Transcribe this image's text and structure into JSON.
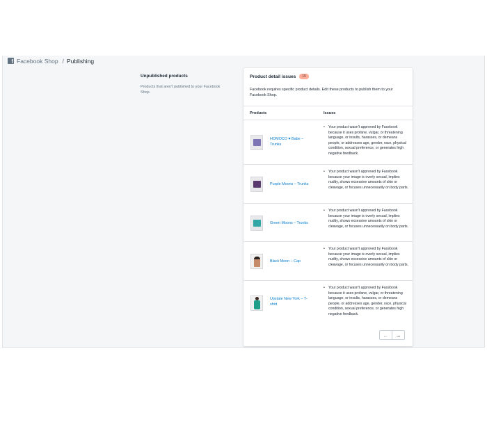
{
  "breadcrumb": {
    "app": "Facebook Shop",
    "current": "Publishing"
  },
  "section": {
    "title": "Unpublished products",
    "description": "Products that aren't published to your Facebook Shop."
  },
  "card": {
    "title": "Product detail issues",
    "badge": "15",
    "description": "Facebook requires specific product details. Edit these products to publish them to your Facebook Shop.",
    "col_products": "Products",
    "col_issues": "Issues"
  },
  "rows": [
    {
      "product": "HOMOCO ♥ Babe – Trunks",
      "issue": "Your product wasn't approved by Facebook because it uses profane, vulgar, or threatening language, or insults, harasses, or demeans people, or addresses age, gender, race, physical condition, sexual preference, or generates high negative feedback.",
      "thumb_color": "#7d74b5"
    },
    {
      "product": "Purple Moons – Trunks",
      "issue": "Your product wasn't approved by Facebook because your image is overly sexual, implies nudity, shows excessive amounts of skin or cleavage, or focuses unnecessarily on body parts.",
      "thumb_color": "#5a3a6e"
    },
    {
      "product": "Green Moons – Trunks",
      "issue": "Your product wasn't approved by Facebook because your image is overly sexual, implies nudity, shows excessive amounts of skin or cleavage, or focuses unnecessarily on body parts.",
      "thumb_color": "#33a6a6"
    },
    {
      "product": "Black Moon – Cap",
      "issue": "Your product wasn't approved by Facebook because your image is overly sexual, implies nudity, shows excessive amounts of skin or cleavage, or focuses unnecessarily on body parts.",
      "thumb_color": "#2b2320"
    },
    {
      "product": "Upstate New York – T-shirt",
      "issue": "Your product wasn't approved by Facebook because it uses profane, vulgar, or threatening language, or insults, harasses, or demeans people, or addresses age, gender, race, physical condition, sexual preference, or generates high negative feedback.",
      "thumb_color": "#1f9e8a"
    }
  ],
  "pagination": {
    "prev": "←",
    "next": "→"
  }
}
